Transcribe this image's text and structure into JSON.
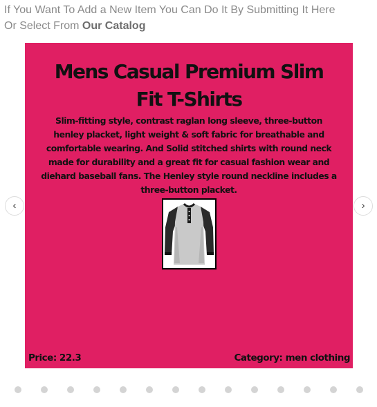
{
  "intro": {
    "line1": "If You Want To Add a New Item You Can Do It By Submitting It Here",
    "line2_prefix": "Or Select From ",
    "catalog_link": "Our Catalog"
  },
  "slide": {
    "background_color": "#e01f63",
    "title": "Mens Casual Premium Slim Fit T-Shirts",
    "description": "Slim-fitting style, contrast raglan long sleeve, three-button henley placket, light weight & soft fabric for breathable and comfortable wearing. And Solid stitched shirts with round neck made for durability and a great fit for casual fashion wear and diehard baseball fans. The Henley style round neckline includes a three-button placket.",
    "price_label": "Price: 22.3",
    "category_label": "Category: men clothing"
  },
  "carousel": {
    "prev_icon": "‹",
    "next_icon": "›",
    "dot_count": 14
  }
}
